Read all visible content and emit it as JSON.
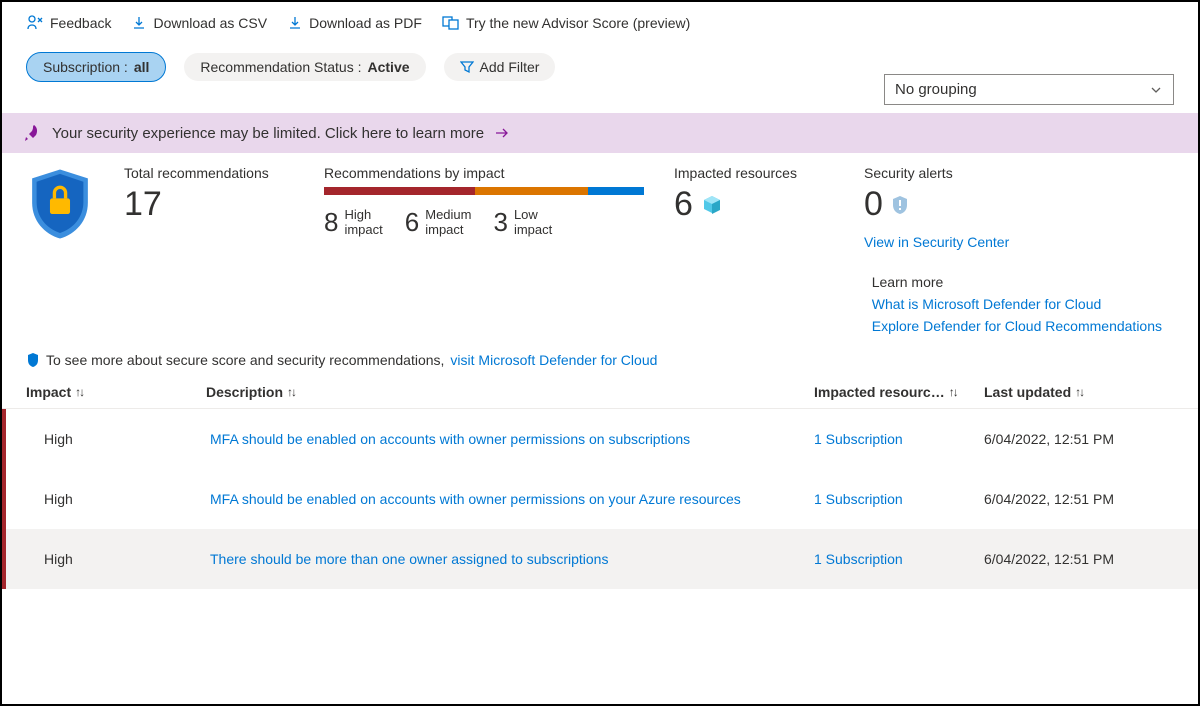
{
  "topbar": {
    "feedback": "Feedback",
    "download_csv": "Download as CSV",
    "download_pdf": "Download as PDF",
    "advisor_preview": "Try the new Advisor Score (preview)"
  },
  "filters": {
    "subscription_label": "Subscription :",
    "subscription_value": "all",
    "status_label": "Recommendation Status :",
    "status_value": "Active",
    "add_filter": "Add Filter"
  },
  "grouping": {
    "selected": "No grouping"
  },
  "banner": {
    "text": "Your security experience may be limited. Click here to learn more"
  },
  "summary": {
    "total_label": "Total recommendations",
    "total_value": "17",
    "by_impact_label": "Recommendations by impact",
    "high_n": "8",
    "high_label": "High\nimpact",
    "medium_n": "6",
    "medium_label": "Medium\nimpact",
    "low_n": "3",
    "low_label": "Low\nimpact",
    "impacted_label": "Impacted resources",
    "impacted_value": "6",
    "alerts_label": "Security alerts",
    "alerts_value": "0",
    "view_sc": "View in Security Center"
  },
  "learn_more": {
    "heading": "Learn more",
    "link1": "What is Microsoft Defender for Cloud",
    "link2": "Explore Defender for Cloud Recommendations"
  },
  "note": {
    "prefix": "To see more about secure score and security recommendations, ",
    "link": "visit Microsoft Defender for Cloud"
  },
  "columns": {
    "impact": "Impact",
    "description": "Description",
    "resources": "Impacted resourc…",
    "updated": "Last updated"
  },
  "rows": [
    {
      "impact": "High",
      "description": "MFA should be enabled on accounts with owner permissions on subscriptions",
      "resources": "1 Subscription",
      "updated": "6/04/2022, 12:51 PM"
    },
    {
      "impact": "High",
      "description": "MFA should be enabled on accounts with owner permissions on your Azure resources",
      "resources": "1 Subscription",
      "updated": "6/04/2022, 12:51 PM"
    },
    {
      "impact": "High",
      "description": "There should be more than one owner assigned to subscriptions",
      "resources": "1 Subscription",
      "updated": "6/04/2022, 12:51 PM"
    }
  ]
}
